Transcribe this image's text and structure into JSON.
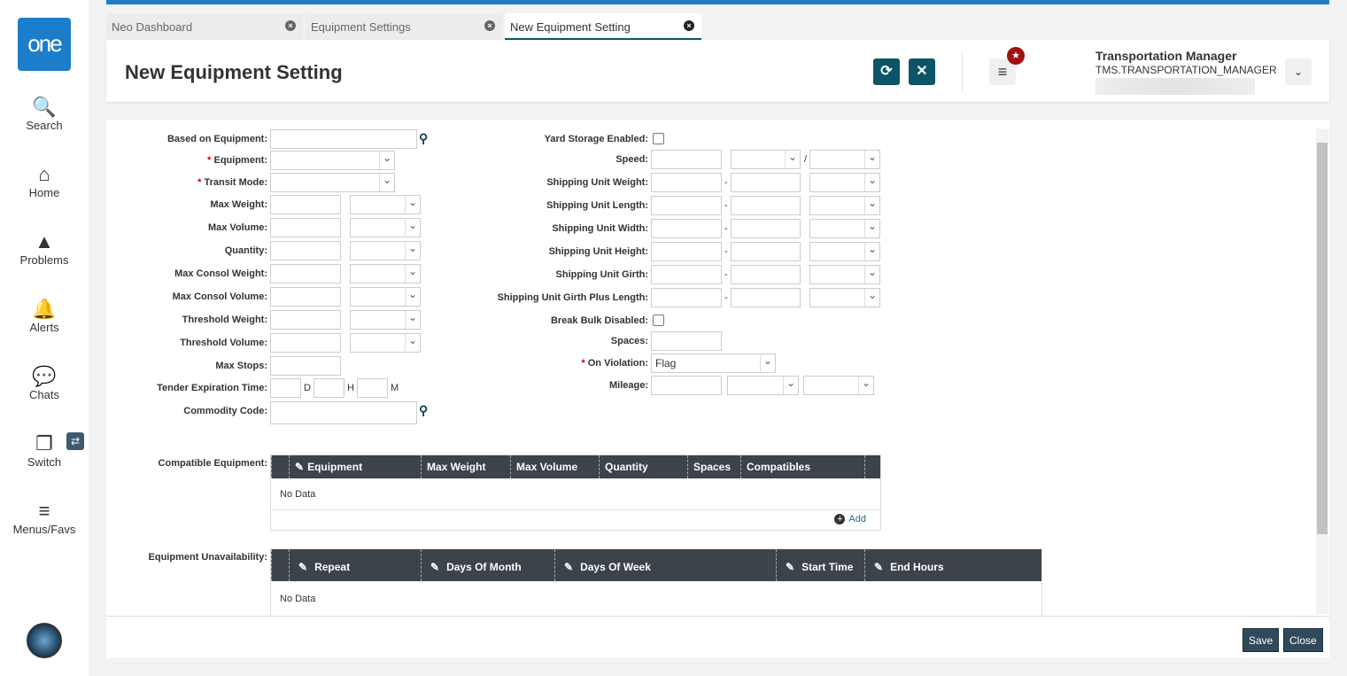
{
  "sidebar": {
    "logo": "one",
    "items": [
      {
        "label": "Search",
        "icon": "search-icon",
        "glyph": "🔍"
      },
      {
        "label": "Home",
        "icon": "home-icon",
        "glyph": "⌂"
      },
      {
        "label": "Problems",
        "icon": "warning-icon",
        "glyph": "▲"
      },
      {
        "label": "Alerts",
        "icon": "bell-icon",
        "glyph": "🔔"
      },
      {
        "label": "Chats",
        "icon": "chat-icon",
        "glyph": "💬"
      },
      {
        "label": "Switch",
        "icon": "switch-icon",
        "glyph": "❐"
      },
      {
        "label": "Menus/Favs",
        "icon": "menu-icon",
        "glyph": "≡"
      }
    ]
  },
  "tabs": [
    {
      "label": "Neo Dashboard"
    },
    {
      "label": "Equipment Settings"
    },
    {
      "label": "New Equipment Setting",
      "active": true
    }
  ],
  "header": {
    "title": "New Equipment Setting",
    "user_name": "Transportation Manager",
    "user_role": "TMS.TRANSPORTATION_MANAGER"
  },
  "form": {
    "left": [
      {
        "label": "Based on Equipment:",
        "kind": "lookup"
      },
      {
        "label": "Equipment:",
        "required": true,
        "kind": "select"
      },
      {
        "label": "Transit Mode:",
        "required": true,
        "kind": "select"
      },
      {
        "label": "Max Weight:",
        "kind": "qty"
      },
      {
        "label": "Max Volume:",
        "kind": "qty"
      },
      {
        "label": "Quantity:",
        "kind": "qty"
      },
      {
        "label": "Max Consol Weight:",
        "kind": "qty"
      },
      {
        "label": "Max Consol Volume:",
        "kind": "qty"
      },
      {
        "label": "Threshold Weight:",
        "kind": "qty"
      },
      {
        "label": "Threshold Volume:",
        "kind": "qty"
      },
      {
        "label": "Max Stops:",
        "kind": "input"
      },
      {
        "label": "Tender Expiration Time:",
        "kind": "dhm",
        "units": [
          "D",
          "H",
          "M"
        ]
      },
      {
        "label": "Commodity Code:",
        "kind": "lookup2"
      }
    ],
    "right": [
      {
        "label": "Yard Storage Enabled:",
        "kind": "check"
      },
      {
        "label": "Speed:",
        "kind": "speed",
        "sep": "/"
      },
      {
        "label": "Shipping Unit Weight:",
        "kind": "range",
        "sep": "-"
      },
      {
        "label": "Shipping Unit Length:",
        "kind": "range",
        "sep": "-"
      },
      {
        "label": "Shipping Unit Width:",
        "kind": "range",
        "sep": "-"
      },
      {
        "label": "Shipping Unit Height:",
        "kind": "range",
        "sep": "-"
      },
      {
        "label": "Shipping Unit Girth:",
        "kind": "range",
        "sep": "-"
      },
      {
        "label": "Shipping Unit Girth Plus Length:",
        "kind": "range",
        "sep": "-"
      },
      {
        "label": "Break Bulk Disabled:",
        "kind": "check"
      },
      {
        "label": "Spaces:",
        "kind": "input"
      },
      {
        "label": "On Violation:",
        "required": true,
        "kind": "violation",
        "value": "Flag"
      },
      {
        "label": "Mileage:",
        "kind": "mileage"
      }
    ]
  },
  "compatible": {
    "label": "Compatible Equipment:",
    "columns": [
      "Equipment",
      "Max Weight",
      "Max Volume",
      "Quantity",
      "Spaces",
      "Compatibles"
    ],
    "empty": "No Data",
    "add": "Add"
  },
  "unavailability": {
    "label": "Equipment Unavailability:",
    "columns": [
      "Repeat",
      "Days Of Month",
      "Days Of Week",
      "Start Time",
      "End Hours"
    ],
    "empty": "No Data"
  },
  "footer": {
    "save": "Save",
    "close": "Close"
  }
}
